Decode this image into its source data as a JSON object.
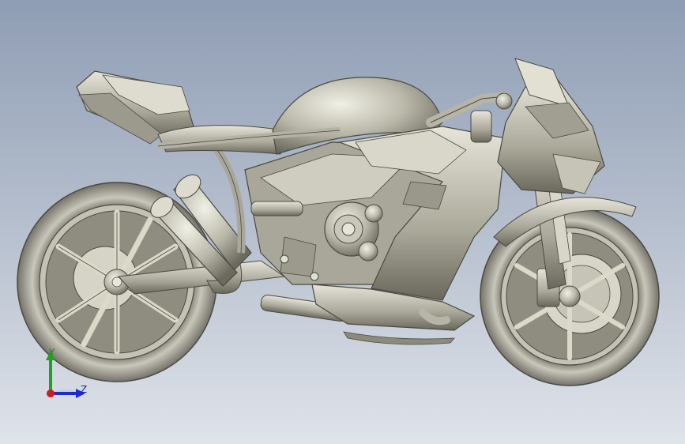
{
  "viewport": {
    "background_top": "#8f9db4",
    "background_bottom": "#dfe3ea",
    "model_color": "#b8b6a8",
    "edge_color": "#4a4a42"
  },
  "model": {
    "name": "motorcycle-3d-model",
    "icon": "motorcycle-icon"
  },
  "triad": {
    "y_label": "Y",
    "z_label": "Z",
    "x_color": "#d01c1c",
    "y_color": "#1fa31f",
    "z_color": "#1c2ad0"
  }
}
